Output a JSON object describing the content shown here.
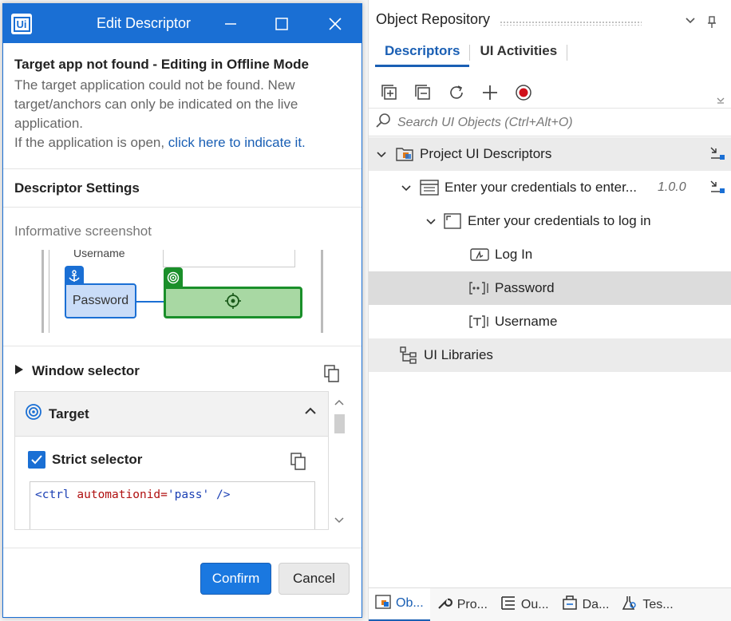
{
  "dialog": {
    "title": "Edit Descriptor",
    "offline_title": "Target app not found - Editing in Offline Mode",
    "offline_text": "The target application could not be found. New target/anchors can only be indicated on the live application.",
    "offline_prompt": "If the application is open, ",
    "offline_link": "click here to indicate it.",
    "descriptor_settings": "Descriptor Settings",
    "informative_screenshot": "Informative screenshot",
    "screenshot": {
      "username_label": "Username",
      "password_label": "Password"
    },
    "window_selector": "Window selector",
    "target_label": "Target",
    "strict_selector": "Strict selector",
    "strict_checked": true,
    "selector_code": {
      "open": "<ctrl",
      "attr": "automationid=",
      "value": "'pass'",
      "close": "/>"
    },
    "confirm": "Confirm",
    "cancel": "Cancel",
    "accent": "#1a6fd4"
  },
  "repository": {
    "title": "Object Repository",
    "tabs": [
      {
        "label": "Descriptors",
        "active": true
      },
      {
        "label": "UI Activities",
        "active": false
      }
    ],
    "search_placeholder": "Search UI Objects (Ctrl+Alt+O)",
    "tree": {
      "project": "Project UI Descriptors",
      "app": "Enter your credentials to enter...",
      "app_version": "1.0.0",
      "screen": "Enter your credentials to log in",
      "elements": [
        "Log In",
        "Password",
        "Username"
      ],
      "libraries": "UI Libraries"
    },
    "bottom_tabs": [
      "Ob...",
      "Pro...",
      "Ou...",
      "Da...",
      "Tes..."
    ]
  }
}
